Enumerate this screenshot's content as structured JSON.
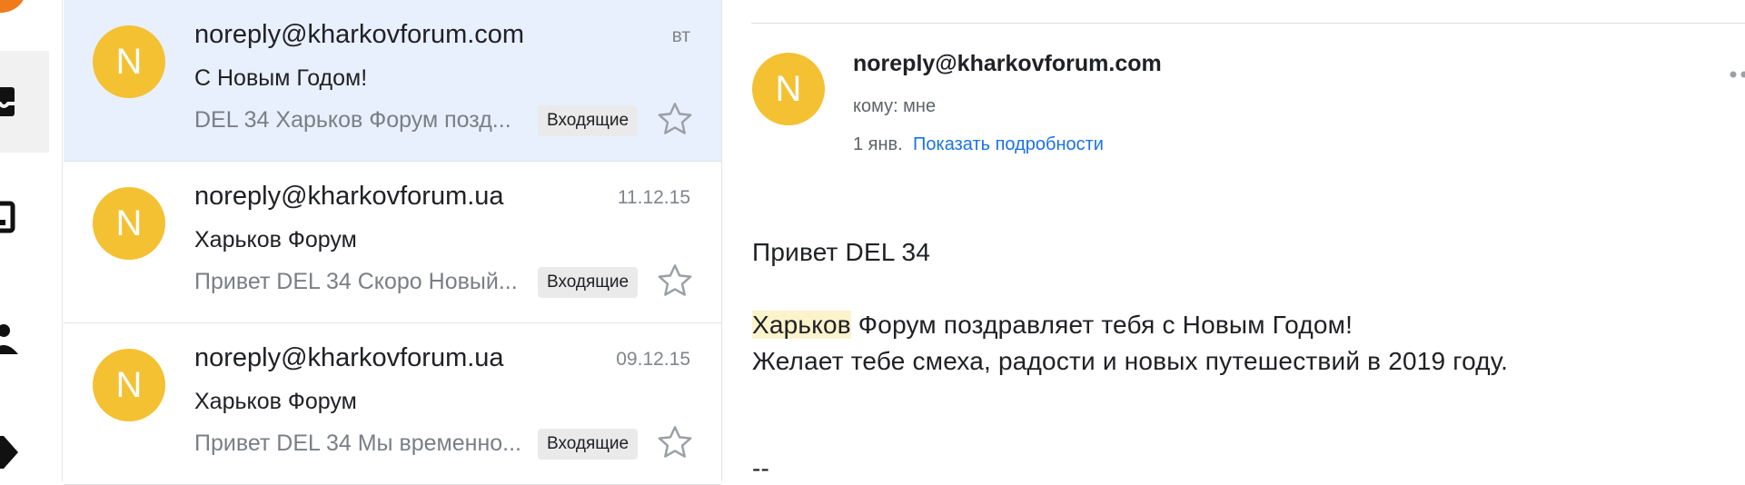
{
  "list": {
    "rows": [
      {
        "avatar_letter": "N",
        "sender": "noreply@kharkovforum.com",
        "date": "вт",
        "subject": "С Новым Годом!",
        "snippet": "DEL 34 Харьков Форум позд...",
        "label": "Входящие"
      },
      {
        "avatar_letter": "N",
        "sender": "noreply@kharkovforum.ua",
        "date": "11.12.15",
        "subject": "Харьков Форум",
        "snippet": "Привет DEL 34 Скоро Новый...",
        "label": "Входящие"
      },
      {
        "avatar_letter": "N",
        "sender": "noreply@kharkovforum.ua",
        "date": "09.12.15",
        "subject": "Харьков Форум",
        "snippet": "Привет DEL 34 Мы временно...",
        "label": "Входящие"
      }
    ]
  },
  "reader": {
    "avatar_letter": "N",
    "sender": "noreply@kharkovforum.com",
    "to": "кому: мне",
    "date": "1 янв.",
    "details_link": "Показать подробности",
    "greeting": "Привет DEL 34",
    "line1_highlight": "Харьков",
    "line1_rest": " Форум поздравляет тебя с Новым Годом!",
    "line2": "Желает тебе смеха, радости и новых путешествий в 2019 году.",
    "signature_sep": "--"
  },
  "colors": {
    "avatar": "#f4c133",
    "selected_row": "#e8f0fe",
    "link": "#1a73e8",
    "highlight": "#fbf3cc",
    "rail_avatar": "#f07b1d"
  },
  "icons": [
    "inbox-icon",
    "chat-icon",
    "people-icon",
    "label-icon",
    "star-icon",
    "more-icon"
  ]
}
